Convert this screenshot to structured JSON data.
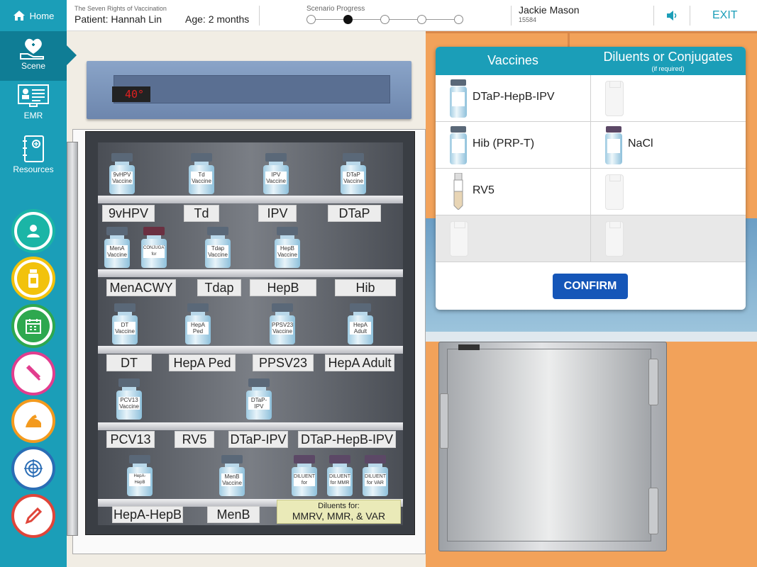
{
  "colors": {
    "teal": "#1b9eb8",
    "teal_dark": "#0f7d95",
    "confirm_blue": "#1556b8",
    "orange": "#f2a25a"
  },
  "sidebar": {
    "home_label": "Home",
    "items": [
      {
        "label": "Scene",
        "icon": "heart-hand-icon"
      },
      {
        "label": "EMR",
        "icon": "monitor-icon"
      },
      {
        "label": "Resources",
        "icon": "binder-icon"
      }
    ],
    "rings": [
      {
        "icon": "person-icon",
        "color": "#1bb5a6"
      },
      {
        "icon": "vial-icon",
        "color": "#f2c20c"
      },
      {
        "icon": "calendar-icon",
        "color": "#2ea84f"
      },
      {
        "icon": "syringe-icon",
        "color": "#e23d8e"
      },
      {
        "icon": "arm-icon",
        "color": "#f39a1e"
      },
      {
        "icon": "target-icon",
        "color": "#2a6db5"
      },
      {
        "icon": "pencil-icon",
        "color": "#e0453a"
      }
    ]
  },
  "topbar": {
    "subtitle": "The Seven Rights of Vaccination",
    "patient": "Patient: Hannah Lin",
    "age": "Age: 2 months",
    "progress_label": "Scenario Progress",
    "progress_steps": 5,
    "progress_current": 2,
    "user_name": "Jackie Mason",
    "user_id": "15584",
    "exit": "EXIT"
  },
  "fridge": {
    "temperature": "40°",
    "shelves": [
      {
        "labels": [
          "9vHPV",
          "Td",
          "IPV",
          "DTaP"
        ],
        "vials": [
          {
            "tag": "9vHPV\nVaccine",
            "cap": "gray"
          },
          {
            "tag": "Td\nVaccine",
            "cap": "gray"
          },
          {
            "tag": "IPV\nVaccine",
            "cap": "gray"
          },
          {
            "tag": "DTaP\nVaccine",
            "cap": "gray"
          }
        ]
      },
      {
        "labels": [
          "MenACWY",
          "Tdap",
          "HepB",
          "Hib"
        ],
        "vials": [
          {
            "tag": "MenA\nVaccine",
            "cap": "gray"
          },
          {
            "tag": "CONJUGATE\nfor MenACWY",
            "cap": "maroon"
          },
          {
            "tag": "Tdap\nVaccine",
            "cap": "gray"
          },
          {
            "tag": "HepB\nVaccine",
            "cap": "gray"
          }
        ]
      },
      {
        "labels": [
          "DT",
          "HepA Ped",
          "PPSV23",
          "HepA Adult"
        ],
        "vials": [
          {
            "tag": "DT\nVaccine",
            "cap": "gray"
          },
          {
            "tag": "HepA Ped\nVaccine",
            "cap": "gray"
          },
          {
            "tag": "PPSV23\nVaccine",
            "cap": "gray"
          },
          {
            "tag": "HepA\nAdult",
            "cap": "gray"
          }
        ]
      },
      {
        "labels": [
          "PCV13",
          "RV5",
          "DTaP-IPV",
          "DTaP-HepB-IPV"
        ],
        "vials": [
          {
            "tag": "PCV13\nVaccine",
            "cap": "gray"
          },
          {
            "tag": "DTaP-IPV\nVaccine",
            "cap": "gray"
          }
        ]
      },
      {
        "labels": [
          "HepA-HepB",
          "MenB"
        ],
        "vials": [
          {
            "tag": "HepA-HepB\nVaccine",
            "cap": "gray"
          },
          {
            "tag": "MenB\nVaccine",
            "cap": "gray"
          },
          {
            "tag": "DILUENT\nfor MMRV",
            "cap": "purple"
          },
          {
            "tag": "DILUENT\nfor MMR",
            "cap": "purple"
          },
          {
            "tag": "DILUENT\nfor VAR",
            "cap": "purple"
          }
        ]
      }
    ],
    "diluent_note_1": "Diluents for:",
    "diluent_note_2": "MMRV, MMR, & VAR"
  },
  "panel": {
    "vaccines_header": "Vaccines",
    "diluents_header": "Diluents or Conjugates",
    "diluents_sub": "(if required)",
    "rows": [
      {
        "vaccine": "DTaP-HepB-IPV",
        "diluent": ""
      },
      {
        "vaccine": "Hib (PRP-T)",
        "diluent": "NaCl"
      },
      {
        "vaccine": "RV5",
        "diluent": ""
      },
      {
        "vaccine": "",
        "diluent": ""
      }
    ],
    "confirm": "CONFIRM"
  }
}
